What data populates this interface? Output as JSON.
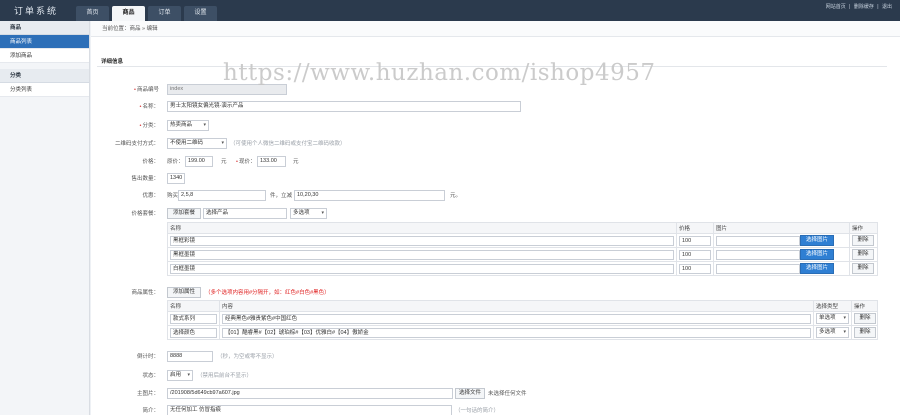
{
  "app": {
    "title": "订单系统"
  },
  "tabs": [
    {
      "label": "首页"
    },
    {
      "label": "商品"
    },
    {
      "label": "订单"
    },
    {
      "label": "设置"
    }
  ],
  "toplinks": [
    "网站首页",
    "|",
    "删除缓存",
    "|",
    "退出"
  ],
  "sidebar": {
    "groups": [
      {
        "label": "商品",
        "items": [
          {
            "label": "商品列表"
          },
          {
            "label": "添加商品"
          }
        ]
      },
      {
        "label": "分类",
        "items": [
          {
            "label": "分类列表"
          }
        ]
      }
    ]
  },
  "breadcrumb": "当前位置：商品 » 编辑",
  "section_title": "详细信息",
  "watermark": "https://www.huzhan.com/ishop4957",
  "form": {
    "sku": {
      "label": "商品编号",
      "value": "index"
    },
    "name": {
      "label": "名称：",
      "value": "男士太阳镜女偏光镜-演示产品"
    },
    "category": {
      "label": "分类：",
      "value": "热卖商品"
    },
    "qrcode": {
      "label": "二维码支付方式：",
      "value": "不使用二维码",
      "hint": "（可使用个人微信二维码或支付宝二维码收款）"
    },
    "price": {
      "label": "价格：",
      "orig_label": "原价：",
      "orig_value": "199.00",
      "unit1": "元",
      "sale_label": "现价：",
      "sale_value": "133.00",
      "unit2": "元"
    },
    "sales": {
      "label": "售出数量：",
      "value": "1340"
    },
    "discount": {
      "label": "优惠：",
      "prefix": "购买",
      "count_value": "2,5,8",
      "middle": "件，立减",
      "amount_value": "10,20,30",
      "suffix": "元。"
    },
    "price_options": {
      "label": "价格套餐：",
      "add_button": "添加套餐",
      "select_product_value": "选择产品",
      "mode_value": "多选项",
      "columns": {
        "name": "名称",
        "price": "价格",
        "image": "图片",
        "action": "操作"
      },
      "rows": [
        {
          "name": "黑框彩镜",
          "price": "100",
          "upload": "选择图片",
          "delete": "删除"
        },
        {
          "name": "黑框墨镜",
          "price": "100",
          "upload": "选择图片",
          "delete": "删除"
        },
        {
          "name": "白框墨镜",
          "price": "100",
          "upload": "选择图片",
          "delete": "删除"
        }
      ]
    },
    "attributes": {
      "label": "商品属性：",
      "add_button": "添加属性",
      "hint": "（多个选项内容用#分隔开，如：红色#白色#黑色）",
      "columns": {
        "name": "名称",
        "content": "内容",
        "type": "选择类型",
        "action": "操作"
      },
      "rows": [
        {
          "name": "款式系列",
          "content": "经典黑色#雅贵紫色#中国红色",
          "type": "单选项",
          "delete": "删除"
        },
        {
          "name": "选择颜色",
          "content": "【01】酷睿黑#【02】琥珀棕#【03】优雅白#【04】傲娇金",
          "type": "多选项",
          "delete": "删除"
        }
      ]
    },
    "countdown": {
      "label": "倒计时：",
      "value": "8888",
      "hint": "（秒，为空或零不显示）"
    },
    "status": {
      "label": "状态：",
      "value": "启用",
      "hint": "（禁用后前台不显示）"
    },
    "main_image": {
      "label": "主图片：",
      "value": "/201908/5d649cb97a607.jpg",
      "button": "选择文件",
      "file_status": "未选择任何文件"
    },
    "intro": {
      "label": "简介：",
      "value": "无任何加工 仿冒指痕",
      "hint": "（一句话的简介）"
    }
  }
}
